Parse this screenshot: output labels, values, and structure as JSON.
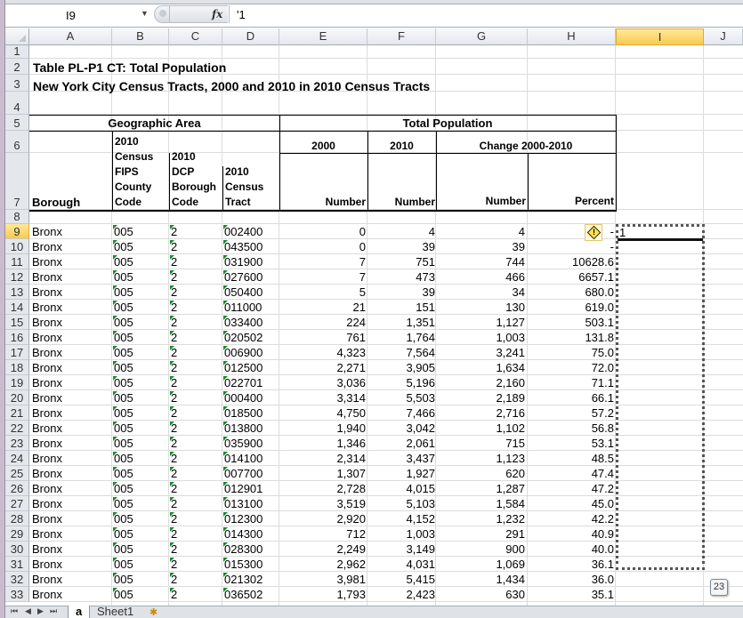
{
  "window": {
    "name_box": "I9",
    "formula_icon": "fx",
    "formula_value": "'1"
  },
  "columns": [
    "A",
    "B",
    "C",
    "D",
    "E",
    "F",
    "G",
    "H",
    "I",
    "J"
  ],
  "selected_column": "I",
  "selected_cell": "I9",
  "rows_visible": [
    "1",
    "2",
    "3",
    "4",
    "5",
    "6",
    "7",
    "8",
    "9",
    "10",
    "11",
    "12",
    "13",
    "14",
    "15",
    "16",
    "17",
    "18",
    "19",
    "20",
    "21",
    "22",
    "23",
    "24",
    "25",
    "26",
    "27",
    "28",
    "29",
    "30",
    "31",
    "32",
    "33"
  ],
  "sheet": {
    "title1": "Table PL-P1 CT:  Total Population",
    "title2": "New York City Census Tracts, 2000 and 2010 in 2010 Census Tracts",
    "header": {
      "geographic_area": "Geographic Area",
      "total_population": "Total Population",
      "year_2000": "2000",
      "year_2010": "2010",
      "change": "Change 2000-2010",
      "borough": "Borough",
      "fips_lines": [
        "2010",
        "Census",
        "FIPS",
        "County",
        "Code"
      ],
      "dcp_lines": [
        "2010",
        "DCP",
        "Borough",
        "Code"
      ],
      "tract_lines": [
        "2010",
        "Census",
        "Tract"
      ],
      "number": "Number",
      "percent": "Percent"
    },
    "rows": [
      {
        "borough": "Bronx",
        "fips": "005",
        "dcp": "2",
        "tract": "002400",
        "p2000": "0",
        "p2010": "4",
        "change": "4",
        "pct": "-"
      },
      {
        "borough": "Bronx",
        "fips": "005",
        "dcp": "2",
        "tract": "043500",
        "p2000": "0",
        "p2010": "39",
        "change": "39",
        "pct": "-"
      },
      {
        "borough": "Bronx",
        "fips": "005",
        "dcp": "2",
        "tract": "031900",
        "p2000": "7",
        "p2010": "751",
        "change": "744",
        "pct": "10628.6"
      },
      {
        "borough": "Bronx",
        "fips": "005",
        "dcp": "2",
        "tract": "027600",
        "p2000": "7",
        "p2010": "473",
        "change": "466",
        "pct": "6657.1"
      },
      {
        "borough": "Bronx",
        "fips": "005",
        "dcp": "2",
        "tract": "050400",
        "p2000": "5",
        "p2010": "39",
        "change": "34",
        "pct": "680.0"
      },
      {
        "borough": "Bronx",
        "fips": "005",
        "dcp": "2",
        "tract": "011000",
        "p2000": "21",
        "p2010": "151",
        "change": "130",
        "pct": "619.0"
      },
      {
        "borough": "Bronx",
        "fips": "005",
        "dcp": "2",
        "tract": "033400",
        "p2000": "224",
        "p2010": "1,351",
        "change": "1,127",
        "pct": "503.1"
      },
      {
        "borough": "Bronx",
        "fips": "005",
        "dcp": "2",
        "tract": "020502",
        "p2000": "761",
        "p2010": "1,764",
        "change": "1,003",
        "pct": "131.8"
      },
      {
        "borough": "Bronx",
        "fips": "005",
        "dcp": "2",
        "tract": "006900",
        "p2000": "4,323",
        "p2010": "7,564",
        "change": "3,241",
        "pct": "75.0"
      },
      {
        "borough": "Bronx",
        "fips": "005",
        "dcp": "2",
        "tract": "012500",
        "p2000": "2,271",
        "p2010": "3,905",
        "change": "1,634",
        "pct": "72.0"
      },
      {
        "borough": "Bronx",
        "fips": "005",
        "dcp": "2",
        "tract": "022701",
        "p2000": "3,036",
        "p2010": "5,196",
        "change": "2,160",
        "pct": "71.1"
      },
      {
        "borough": "Bronx",
        "fips": "005",
        "dcp": "2",
        "tract": "000400",
        "p2000": "3,314",
        "p2010": "5,503",
        "change": "2,189",
        "pct": "66.1"
      },
      {
        "borough": "Bronx",
        "fips": "005",
        "dcp": "2",
        "tract": "018500",
        "p2000": "4,750",
        "p2010": "7,466",
        "change": "2,716",
        "pct": "57.2"
      },
      {
        "borough": "Bronx",
        "fips": "005",
        "dcp": "2",
        "tract": "013800",
        "p2000": "1,940",
        "p2010": "3,042",
        "change": "1,102",
        "pct": "56.8"
      },
      {
        "borough": "Bronx",
        "fips": "005",
        "dcp": "2",
        "tract": "035900",
        "p2000": "1,346",
        "p2010": "2,061",
        "change": "715",
        "pct": "53.1"
      },
      {
        "borough": "Bronx",
        "fips": "005",
        "dcp": "2",
        "tract": "014100",
        "p2000": "2,314",
        "p2010": "3,437",
        "change": "1,123",
        "pct": "48.5"
      },
      {
        "borough": "Bronx",
        "fips": "005",
        "dcp": "2",
        "tract": "007700",
        "p2000": "1,307",
        "p2010": "1,927",
        "change": "620",
        "pct": "47.4"
      },
      {
        "borough": "Bronx",
        "fips": "005",
        "dcp": "2",
        "tract": "012901",
        "p2000": "2,728",
        "p2010": "4,015",
        "change": "1,287",
        "pct": "47.2"
      },
      {
        "borough": "Bronx",
        "fips": "005",
        "dcp": "2",
        "tract": "013100",
        "p2000": "3,519",
        "p2010": "5,103",
        "change": "1,584",
        "pct": "45.0"
      },
      {
        "borough": "Bronx",
        "fips": "005",
        "dcp": "2",
        "tract": "012300",
        "p2000": "2,920",
        "p2010": "4,152",
        "change": "1,232",
        "pct": "42.2"
      },
      {
        "borough": "Bronx",
        "fips": "005",
        "dcp": "2",
        "tract": "014300",
        "p2000": "712",
        "p2010": "1,003",
        "change": "291",
        "pct": "40.9"
      },
      {
        "borough": "Bronx",
        "fips": "005",
        "dcp": "2",
        "tract": "028300",
        "p2000": "2,249",
        "p2010": "3,149",
        "change": "900",
        "pct": "40.0"
      },
      {
        "borough": "Bronx",
        "fips": "005",
        "dcp": "2",
        "tract": "015300",
        "p2000": "2,962",
        "p2010": "4,031",
        "change": "1,069",
        "pct": "36.1"
      },
      {
        "borough": "Bronx",
        "fips": "005",
        "dcp": "2",
        "tract": "021302",
        "p2000": "3,981",
        "p2010": "5,415",
        "change": "1,434",
        "pct": "36.0"
      },
      {
        "borough": "Bronx",
        "fips": "005",
        "dcp": "2",
        "tract": "036502",
        "p2000": "1,793",
        "p2010": "2,423",
        "change": "630",
        "pct": "35.1"
      }
    ],
    "editing_cell_value": "1"
  },
  "paste_options_label": "23",
  "sheet_tabs": [
    {
      "label": "a",
      "active": true
    },
    {
      "label": "Sheet1",
      "active": false
    }
  ],
  "icons": {
    "error_indicator": "warning-diamond",
    "insert_sheet": "insert-worksheet"
  }
}
